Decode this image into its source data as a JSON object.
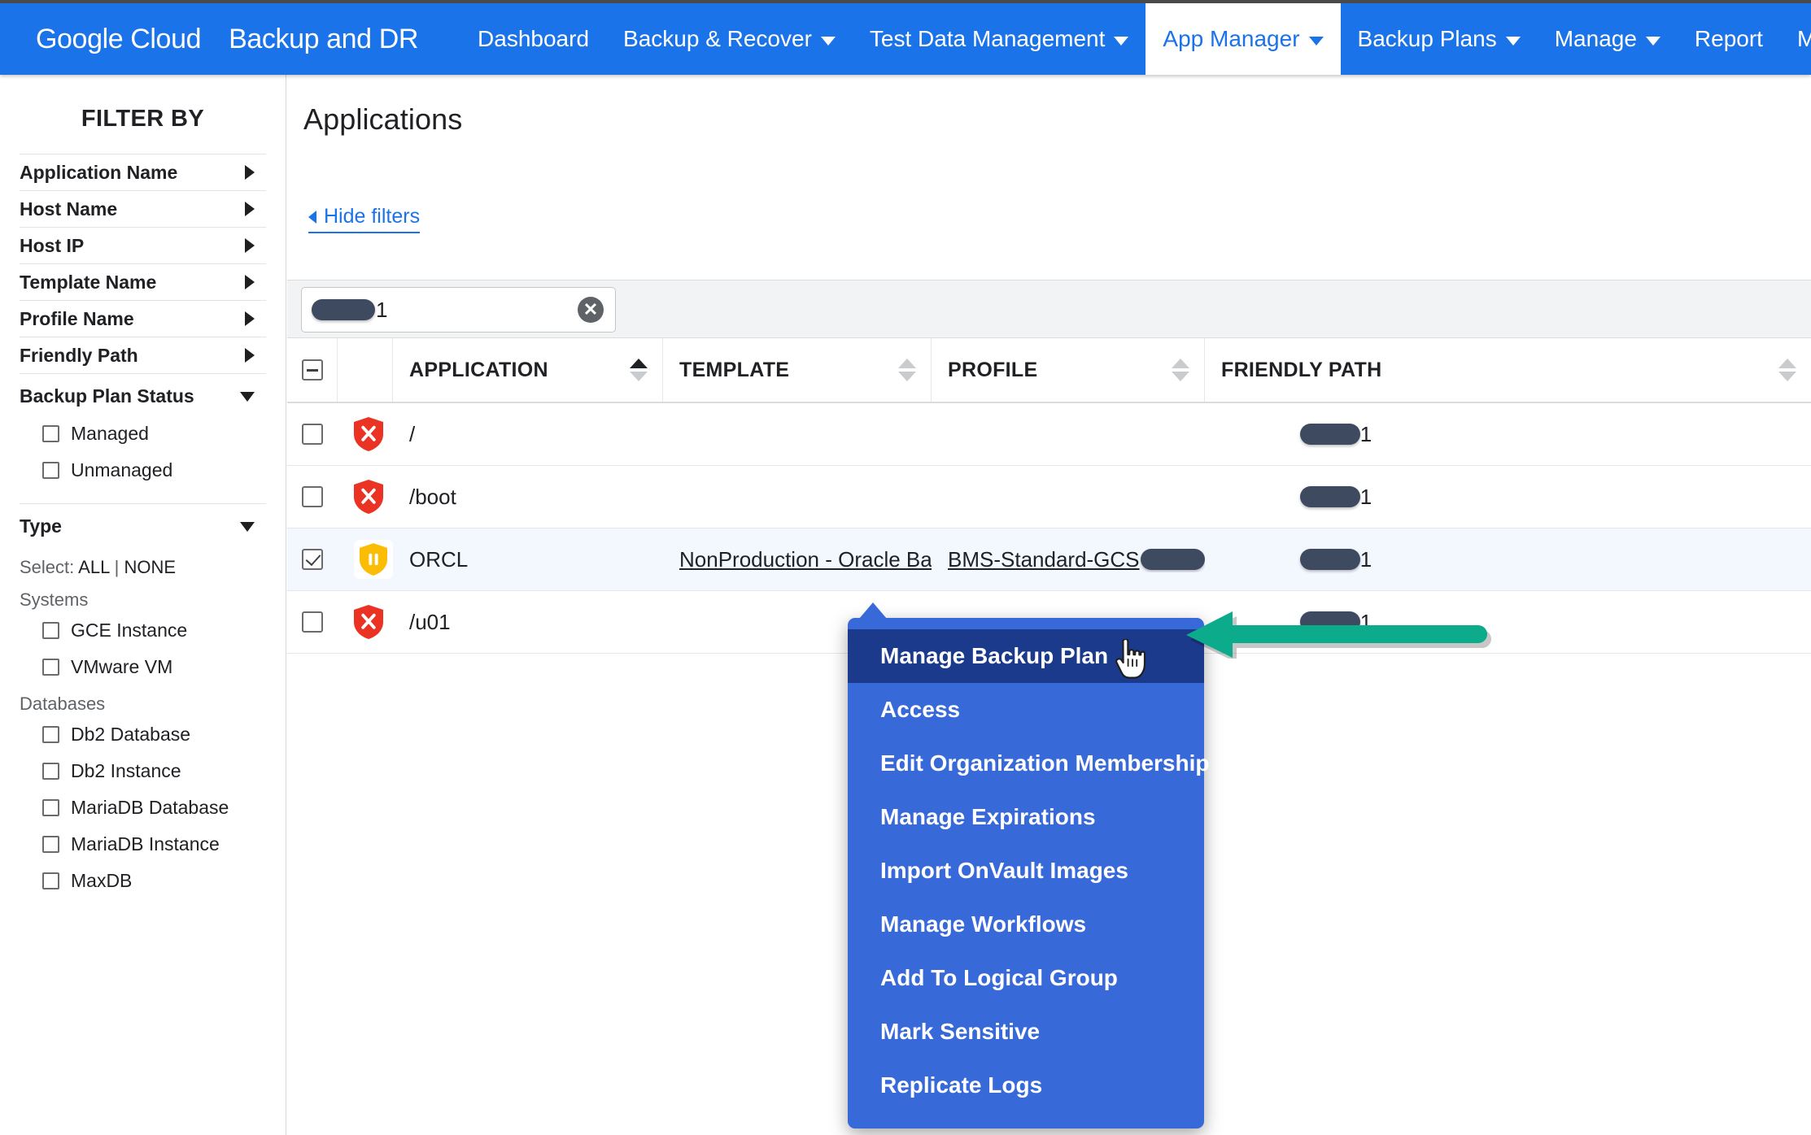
{
  "topnav": {
    "brand_google": "Google",
    "brand_cloud": "Cloud",
    "product": "Backup and DR",
    "accent_color": "#1a73e8",
    "items": [
      {
        "label": "Dashboard",
        "has_caret": false,
        "active": false
      },
      {
        "label": "Backup & Recover",
        "has_caret": true,
        "active": false
      },
      {
        "label": "Test Data Management",
        "has_caret": true,
        "active": false
      },
      {
        "label": "App Manager",
        "has_caret": true,
        "active": true
      },
      {
        "label": "Backup Plans",
        "has_caret": true,
        "active": false
      },
      {
        "label": "Manage",
        "has_caret": true,
        "active": false
      },
      {
        "label": "Report",
        "has_caret": false,
        "active": false
      },
      {
        "label": "Monitor",
        "has_caret": true,
        "active": false
      }
    ]
  },
  "sidebar": {
    "title": "FILTER BY",
    "filters": [
      {
        "label": "Application Name",
        "expanded": false
      },
      {
        "label": "Host Name",
        "expanded": false
      },
      {
        "label": "Host IP",
        "expanded": false
      },
      {
        "label": "Template Name",
        "expanded": false
      },
      {
        "label": "Profile Name",
        "expanded": false
      },
      {
        "label": "Friendly Path",
        "expanded": false
      }
    ],
    "backup_plan_status": {
      "label": "Backup Plan Status",
      "expanded": true,
      "options": [
        {
          "label": "Managed",
          "checked": false
        },
        {
          "label": "Unmanaged",
          "checked": false
        }
      ]
    },
    "type": {
      "label": "Type",
      "expanded": true,
      "select_prefix": "Select:",
      "select_all": "ALL",
      "select_divider": "|",
      "select_none": "NONE",
      "groups": [
        {
          "name": "Systems",
          "options": [
            {
              "label": "GCE Instance",
              "checked": false
            },
            {
              "label": "VMware VM",
              "checked": false
            }
          ]
        },
        {
          "name": "Databases",
          "options": [
            {
              "label": "Db2 Database",
              "checked": false
            },
            {
              "label": "Db2 Instance",
              "checked": false
            },
            {
              "label": "MariaDB Database",
              "checked": false
            },
            {
              "label": "MariaDB Instance",
              "checked": false
            },
            {
              "label": "MaxDB",
              "checked": false
            }
          ]
        }
      ]
    }
  },
  "main": {
    "page_title": "Applications",
    "hide_filters_label": "Hide filters",
    "search": {
      "value_redacted": true,
      "value_suffix": "1",
      "clear_icon": "clear-circle-icon"
    },
    "table": {
      "header_checkbox_state": "indeterminate",
      "columns": [
        {
          "key": "application",
          "label": "APPLICATION",
          "sort": "asc"
        },
        {
          "key": "template",
          "label": "TEMPLATE",
          "sort": "none"
        },
        {
          "key": "profile",
          "label": "PROFILE",
          "sort": "none"
        },
        {
          "key": "friendly_path",
          "label": "FRIENDLY PATH",
          "sort": "none"
        }
      ],
      "rows": [
        {
          "checked": false,
          "status_icon": "shield-error-icon",
          "status_color": "#ea3323",
          "application": "/",
          "template": "",
          "profile": "",
          "friendly_path_redacted": true,
          "friendly_path_suffix": "1",
          "selected": false
        },
        {
          "checked": false,
          "status_icon": "shield-error-icon",
          "status_color": "#ea3323",
          "application": "/boot",
          "template": "",
          "profile": "",
          "friendly_path_redacted": true,
          "friendly_path_suffix": "1",
          "selected": false
        },
        {
          "checked": true,
          "status_icon": "shield-paused-icon",
          "status_color": "#fbbc04",
          "application": "ORCL",
          "template": "NonProduction - Oracle Ba…",
          "profile": "BMS-Standard-GCS",
          "profile_redacted": true,
          "friendly_path_redacted": true,
          "friendly_path_suffix": "1",
          "selected": true
        },
        {
          "checked": false,
          "status_icon": "shield-error-icon",
          "status_color": "#ea3323",
          "application": "/u01",
          "template": "",
          "profile": "",
          "friendly_path_redacted": true,
          "friendly_path_suffix": "1",
          "selected": false
        }
      ]
    }
  },
  "context_menu": {
    "background_color": "#3769d8",
    "highlight_color": "#1b3a8c",
    "items": [
      {
        "label": "Manage Backup Plan",
        "highlighted": true
      },
      {
        "label": "Access",
        "highlighted": false
      },
      {
        "label": "Edit Organization Membership",
        "highlighted": false
      },
      {
        "label": "Manage Expirations",
        "highlighted": false
      },
      {
        "label": "Import OnVault Images",
        "highlighted": false
      },
      {
        "label": "Manage Workflows",
        "highlighted": false
      },
      {
        "label": "Add To Logical Group",
        "highlighted": false
      },
      {
        "label": "Mark Sensitive",
        "highlighted": false
      },
      {
        "label": "Replicate Logs",
        "highlighted": false
      }
    ]
  },
  "annotation": {
    "arrow_icon": "arrow-left-annotation",
    "color": "#0cab8b",
    "points_to": "Manage Backup Plan"
  },
  "cursor": {
    "icon": "pointer-hand-cursor"
  }
}
